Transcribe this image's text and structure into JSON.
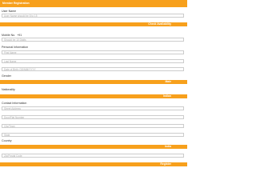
{
  "header": {
    "title": "Member Registration"
  },
  "user_name": {
    "label": "User Name",
    "placeholder": "User Name should be 8 to 15",
    "check_button": "Check Availability"
  },
  "mobile": {
    "label": "Mobile No.",
    "prefix": "+91",
    "placeholder": "Should be 10 Digits"
  },
  "personal": {
    "label": "Personal Information",
    "first_name_placeholder": "First Name",
    "last_name_placeholder": "Last Name",
    "dob_placeholder": "Date of Birth: DD/MM/YYYY"
  },
  "gender": {
    "label": "Gender",
    "select_value": "Male"
  },
  "nationality": {
    "label": "Nationality",
    "select_value": "Indian"
  },
  "contact": {
    "label": "Contact Information",
    "street_placeholder": "Street Address",
    "door_placeholder": "Door/Flat Number",
    "city_placeholder": "City/Town",
    "state_placeholder": "State"
  },
  "country": {
    "label": "Country",
    "select_value": "India",
    "zip_placeholder": "Zip/Postal Code"
  },
  "footer": {
    "submit_label": "Register"
  },
  "colors": {
    "accent": "#f7a01c",
    "border": "#cccccc"
  }
}
